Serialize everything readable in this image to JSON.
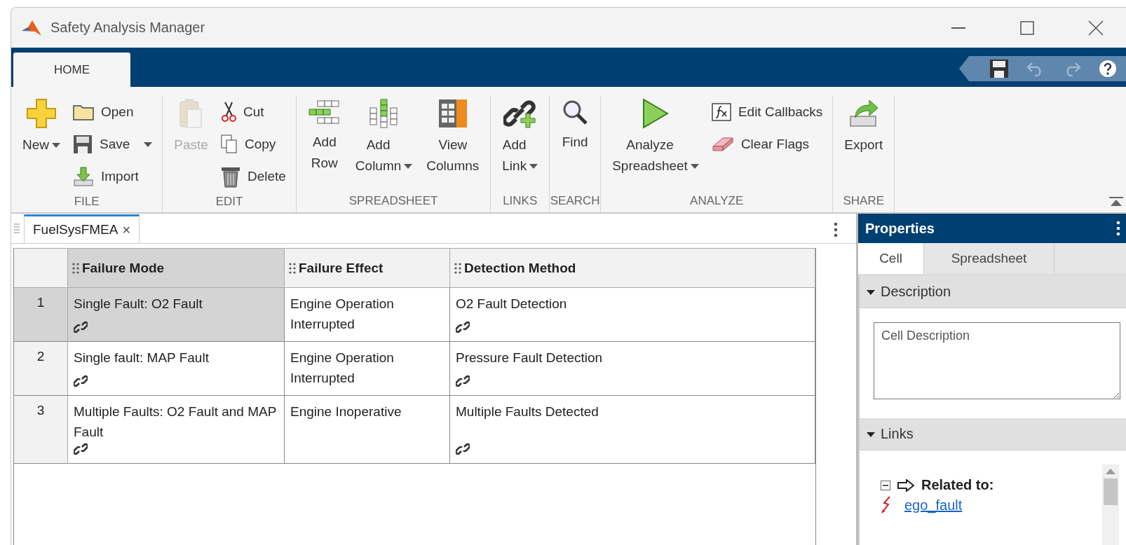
{
  "window": {
    "title": "Safety Analysis Manager"
  },
  "ribbon_tabs": [
    {
      "label": "HOME",
      "selected": true
    }
  ],
  "toolbar_groups": [
    {
      "label": "FILE",
      "columns": [
        {
          "kind": "large",
          "label": "New",
          "dropdown": true,
          "disabled": false
        },
        {
          "kind": "stack",
          "items": [
            {
              "label": "Open",
              "dropdown": false
            },
            {
              "label": "Save",
              "dropdown": true
            },
            {
              "label": "Import",
              "dropdown": false
            }
          ]
        }
      ]
    },
    {
      "label": "EDIT",
      "columns": [
        {
          "kind": "large",
          "label": "Paste",
          "dropdown": false,
          "disabled": true
        },
        {
          "kind": "stack",
          "items": [
            {
              "label": "Cut",
              "dropdown": false
            },
            {
              "label": "Copy",
              "dropdown": false
            },
            {
              "label": "Delete",
              "dropdown": false
            }
          ]
        }
      ]
    },
    {
      "label": "SPREADSHEET",
      "columns": [
        {
          "kind": "large",
          "label": "Add Row",
          "dropdown": false,
          "disabled": false
        },
        {
          "kind": "large",
          "label": "Add Column",
          "dropdown": true,
          "disabled": false
        },
        {
          "kind": "large",
          "label": "View Columns",
          "dropdown": false,
          "disabled": false
        }
      ]
    },
    {
      "label": "LINKS",
      "columns": [
        {
          "kind": "large",
          "label": "Add Link",
          "dropdown": true,
          "disabled": false
        }
      ]
    },
    {
      "label": "SEARCH",
      "columns": [
        {
          "kind": "large",
          "label": "Find",
          "dropdown": false,
          "disabled": false
        }
      ]
    },
    {
      "label": "ANALYZE",
      "columns": [
        {
          "kind": "large",
          "label": "Analyze Spreadsheet",
          "dropdown": true,
          "disabled": false
        },
        {
          "kind": "stack",
          "items": [
            {
              "label": "Edit Callbacks",
              "dropdown": false
            },
            {
              "label": "Clear Flags",
              "dropdown": false
            }
          ]
        }
      ]
    },
    {
      "label": "SHARE",
      "columns": [
        {
          "kind": "large",
          "label": "Export",
          "dropdown": false,
          "disabled": false
        }
      ]
    }
  ],
  "document_tabs": [
    {
      "label": "FuelSysFMEA",
      "close": "×",
      "selected": true
    }
  ],
  "table": {
    "columns": [
      {
        "label": "Failure Mode",
        "selected": true
      },
      {
        "label": "Failure Effect",
        "selected": false
      },
      {
        "label": "Detection Method",
        "selected": false
      }
    ],
    "rows": [
      {
        "number": "1",
        "selected": true,
        "cells": [
          {
            "text": "Single Fault: O2 Fault",
            "linked": true
          },
          {
            "text": "Engine Operation Interrupted",
            "linked": false
          },
          {
            "text": "O2 Fault Detection",
            "linked": true
          }
        ]
      },
      {
        "number": "2",
        "selected": false,
        "cells": [
          {
            "text": "Single fault: MAP Fault",
            "linked": true
          },
          {
            "text": "Engine Operation Interrupted",
            "linked": false
          },
          {
            "text": "Pressure Fault Detection",
            "linked": true
          }
        ]
      },
      {
        "number": "3",
        "selected": false,
        "cells": [
          {
            "text": "Multiple Faults: O2 Fault and MAP Fault",
            "linked": true
          },
          {
            "text": "Engine Inoperative",
            "linked": false
          },
          {
            "text": "Multiple Faults Detected",
            "linked": true
          }
        ]
      }
    ]
  },
  "properties": {
    "title": "Properties",
    "tabs": [
      {
        "label": "Cell",
        "selected": true
      },
      {
        "label": "Spreadsheet",
        "selected": false
      }
    ],
    "description": {
      "title": "Description",
      "expanded": true,
      "value": "Cell Description"
    },
    "links": {
      "title": "Links",
      "expanded": true,
      "tree": [
        {
          "label": "Related to:",
          "expanded": true,
          "children": [
            {
              "label": "ego_fault"
            }
          ]
        }
      ]
    }
  }
}
